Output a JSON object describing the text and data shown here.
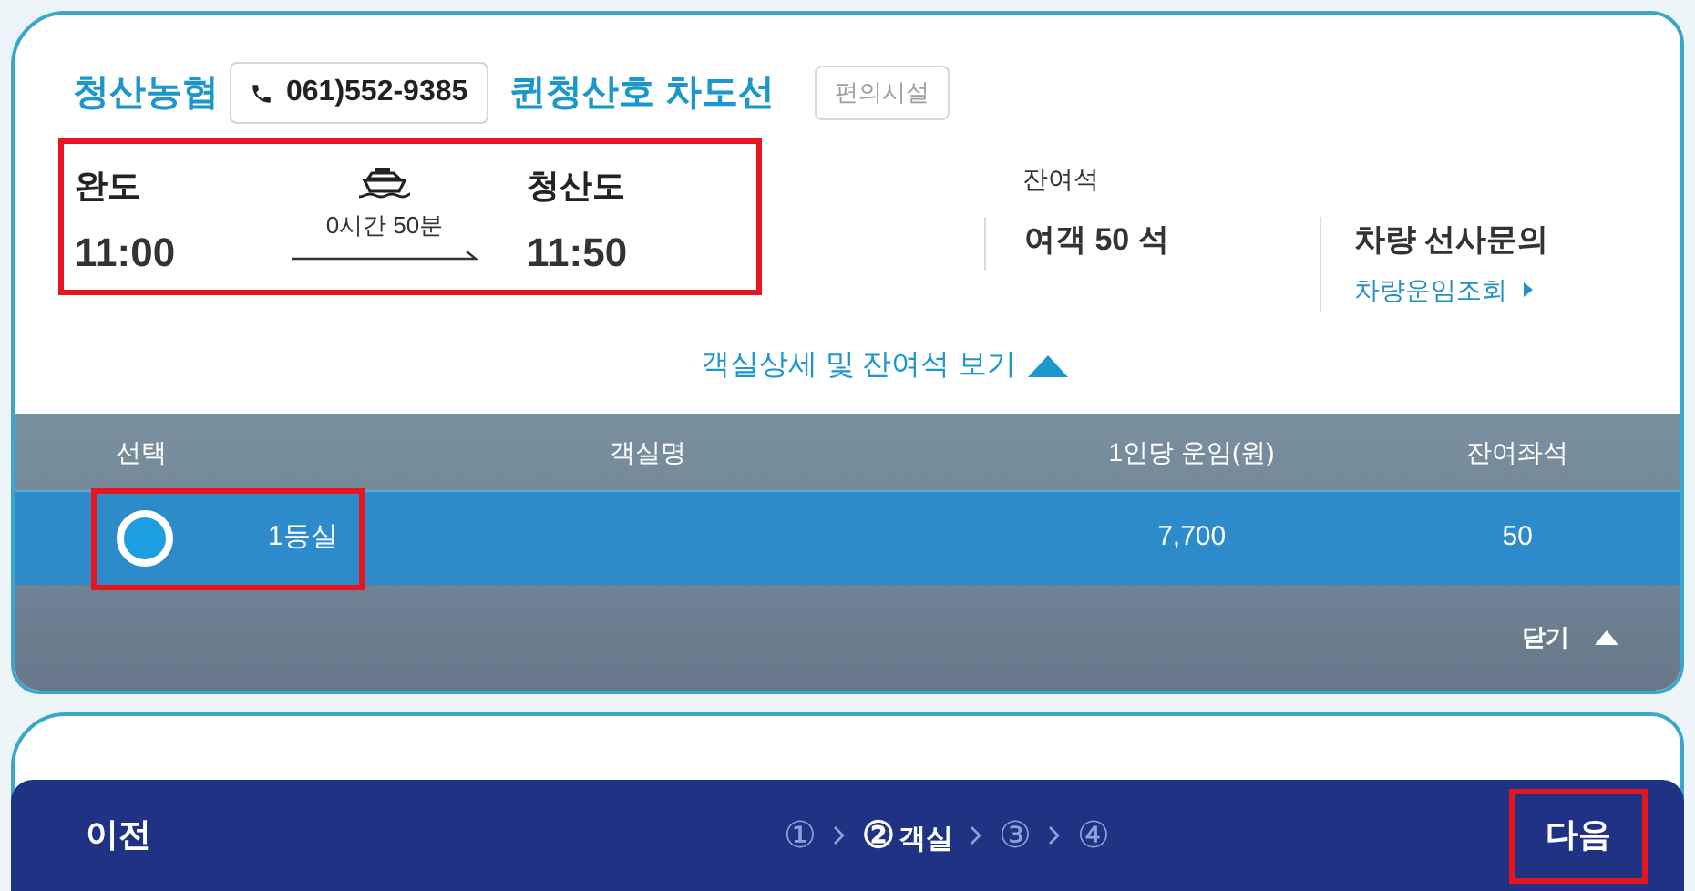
{
  "operator": {
    "name": "청산농협",
    "phone": "061)552-9385"
  },
  "ship": {
    "name": "퀸청산호 차도선",
    "facilities_button": "편의시설"
  },
  "route": {
    "highlighted": true,
    "departure": {
      "port": "완도",
      "time": "11:00"
    },
    "duration": "0시간 50분",
    "arrival": {
      "port": "청산도",
      "time": "11:50"
    }
  },
  "remaining": {
    "label": "잔여석",
    "passenger": "여객 50 석",
    "vehicle": "차량 선사문의",
    "vehicle_link": "차량운임조회"
  },
  "details_toggle": {
    "label": "객실상세 및 잔여석 보기",
    "expanded": true
  },
  "room_table": {
    "columns": [
      "선택",
      "객실명",
      "1인당 운임(원)",
      "잔여좌석"
    ],
    "rows": [
      {
        "selected": true,
        "highlighted": true,
        "name": "1등실",
        "fare": "7,700",
        "seats": "50"
      }
    ],
    "close_button": "닫기"
  },
  "nav": {
    "prev": "이전",
    "steps": [
      {
        "number": "①",
        "selected": false
      },
      {
        "number": "②",
        "label": "객실",
        "selected": true
      },
      {
        "number": "③",
        "selected": false
      },
      {
        "number": "④",
        "selected": false
      }
    ],
    "next": {
      "label": "다음",
      "highlighted": true
    }
  }
}
